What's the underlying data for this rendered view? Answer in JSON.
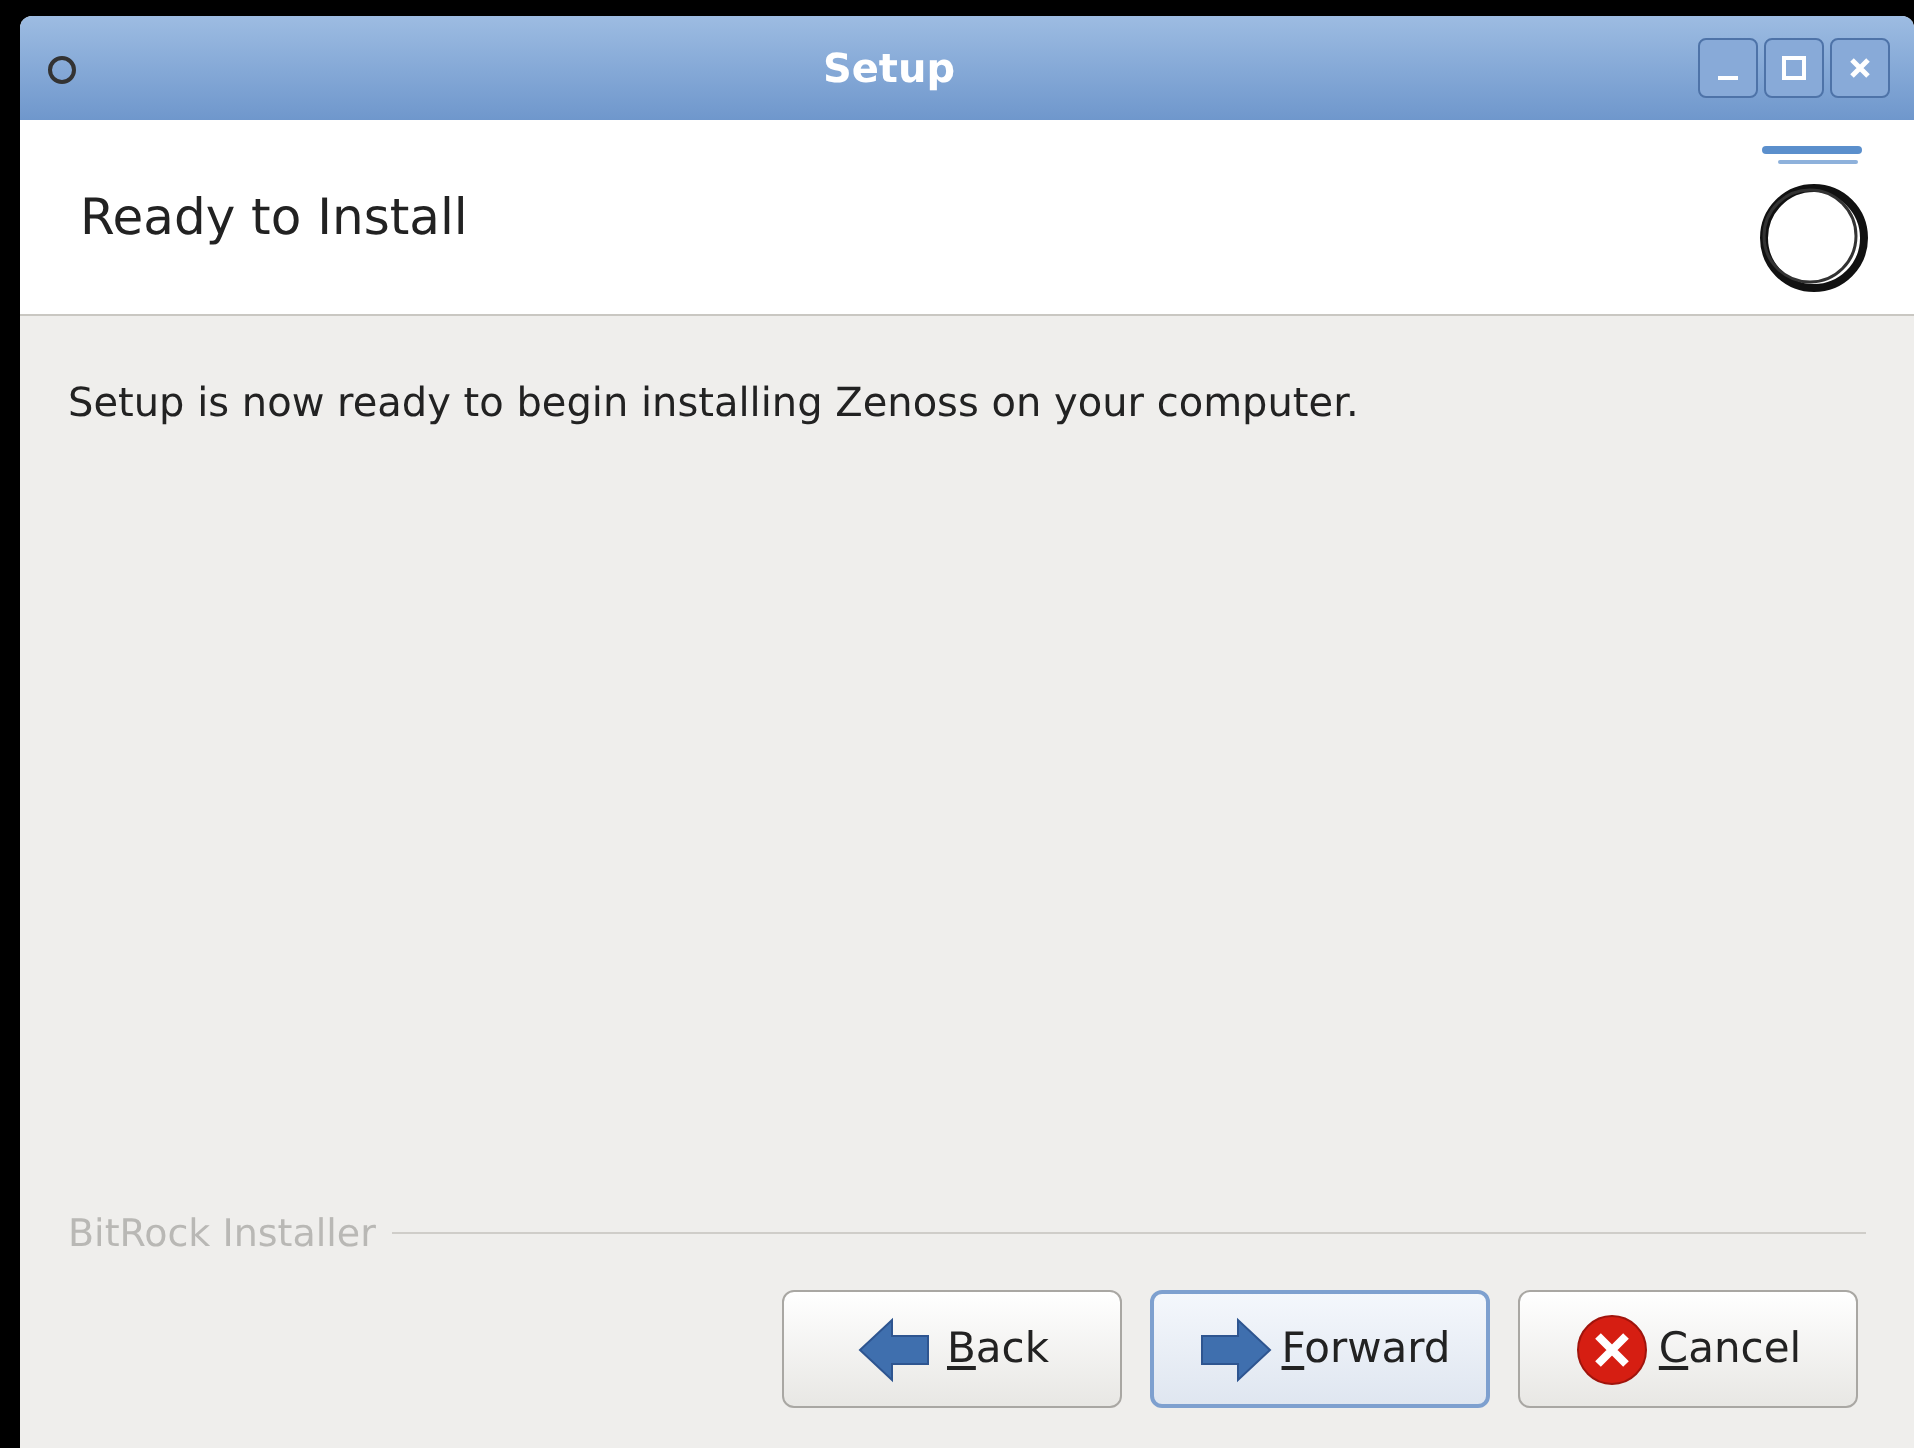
{
  "window": {
    "title": "Setup"
  },
  "header": {
    "title": "Ready to Install"
  },
  "message": "Setup is now ready to begin installing Zenoss on your computer.",
  "footer_label": "BitRock Installer",
  "buttons": [
    {
      "kind": "back",
      "mnemonic": "B",
      "rest": "ack",
      "focused": false
    },
    {
      "kind": "forward",
      "mnemonic": "F",
      "rest": "orward",
      "focused": true
    },
    {
      "kind": "cancel",
      "mnemonic": "C",
      "rest": "ancel",
      "focused": false
    }
  ]
}
